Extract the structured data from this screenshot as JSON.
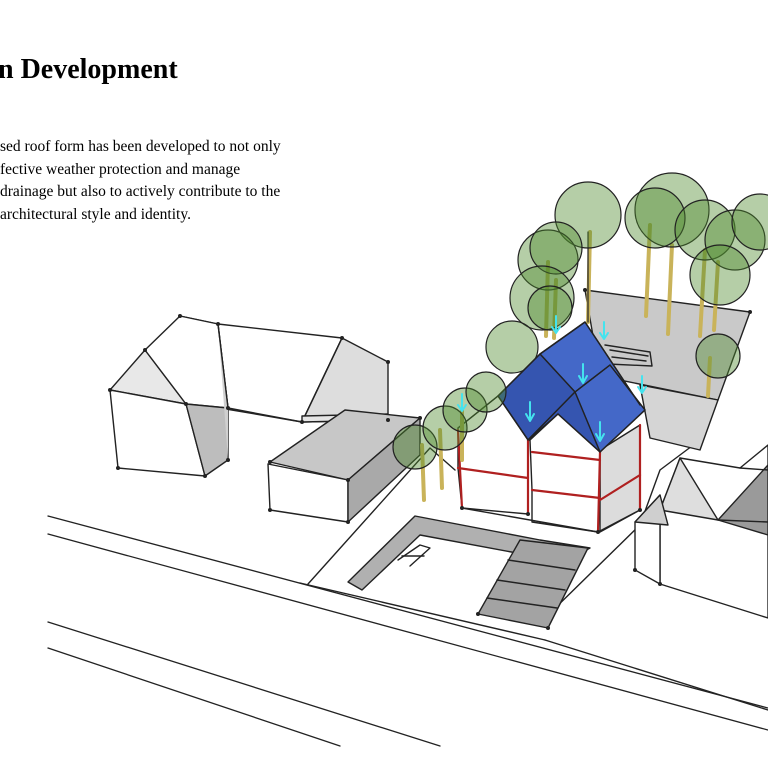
{
  "header": {
    "title": "n Development"
  },
  "description": {
    "lines": [
      "sed roof form has been developed to not only",
      "fective weather protection and manage",
      "drainage but also to actively contribute to the",
      "architectural style and identity."
    ]
  },
  "colors": {
    "roof": "#4468c8",
    "roof_dark": "#3555b0",
    "tree_fill": "#4f8a2e",
    "trunk": "#c9b35a",
    "arrow": "#44e3ee",
    "facade_band": "#b02020",
    "wall_light": "#ffffff",
    "wall_shade": "#dcdcdc",
    "roof_shade": "#c6c6c6",
    "paving": "#a9a9a9",
    "line": "#222222"
  },
  "icons": {
    "arrow": "down-arrow-icon",
    "tree": "tree-icon"
  }
}
